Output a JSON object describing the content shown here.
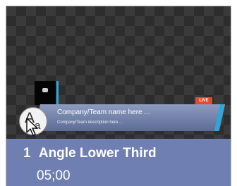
{
  "item": {
    "number": "1",
    "title": "Angle Lower Third",
    "duration": "05;00"
  },
  "preview": {
    "company_name": "Company/Team name here ...",
    "company_description": "Company/Team description here ...",
    "badge": "LIVE",
    "fonts_icon_big": "A",
    "fonts_icon_small": "a"
  },
  "colors": {
    "accent": "#29a8e0",
    "footer": "#6f7fb1",
    "badge": "#e24a2f"
  }
}
